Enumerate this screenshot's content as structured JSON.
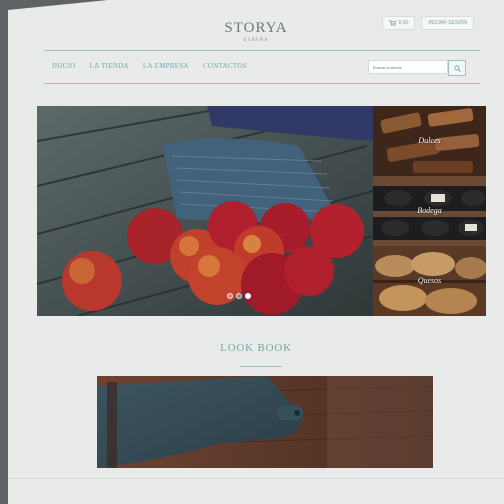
{
  "header": {
    "logo": "STORYA",
    "logo_sub": "· ESPAÑA ·",
    "cart_label": "0,00",
    "login_label": "INICIAR SESIÓN",
    "cart_icon": "shopping-cart-icon"
  },
  "nav": {
    "items": [
      "INICIO",
      "LA TIENDA",
      "LA EMPRESA",
      "CONTACTOS"
    ]
  },
  "search": {
    "placeholder": "Buscar la tienda",
    "icon": "search-icon"
  },
  "hero": {
    "slides": 3,
    "active_slide": 3
  },
  "categories": [
    {
      "label": "Dulces"
    },
    {
      "label": "Bodega"
    },
    {
      "label": "Quesos"
    }
  ],
  "section": {
    "title": "LOOK BOOK"
  },
  "colors": {
    "accent": "#6fa7a5",
    "background": "#e9ebea",
    "frame": "#5f6366"
  }
}
